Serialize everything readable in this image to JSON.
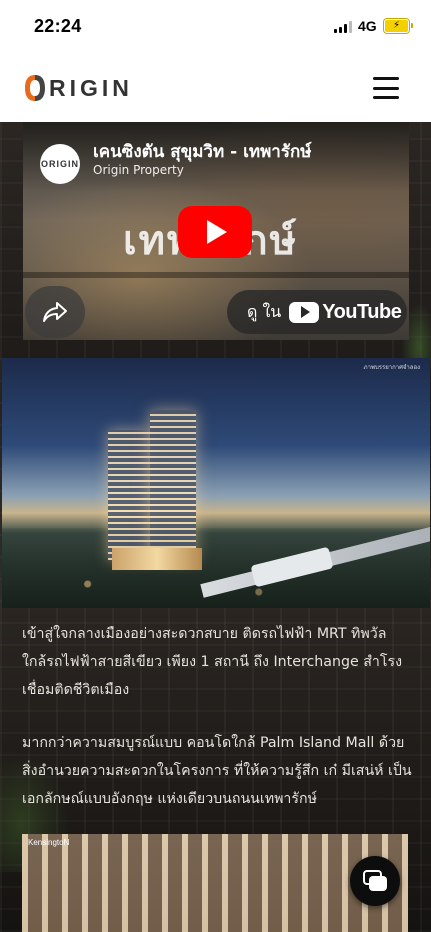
{
  "status_bar": {
    "time": "22:24",
    "network": "4G",
    "battery_icon": "battery-charging-icon"
  },
  "header": {
    "logo_text": "RIGIN",
    "logo_icon": "origin-logo-mark",
    "menu_icon": "hamburger-menu-icon"
  },
  "video": {
    "title": "เคนซิงตัน สุขุมวิท - เทพารักษ์",
    "channel": "Origin Property",
    "avatar_text": "ORIGIN",
    "frame_text": "เทพารักษ์",
    "play_icon": "play-icon",
    "share_icon": "share-icon",
    "watch_on_label": "ดู ใน",
    "youtube_label": "YouTube"
  },
  "render": {
    "caption": "ภาพบรรยากาศจำลอง"
  },
  "description": {
    "p1": "เข้าสู่ใจกลางเมืองอย่างสะดวกสบาย ติดรถไฟฟ้า MRT ทิพวัล ใกล้รถไฟฟ้าสายสีเขียว เพียง 1 สถานี ถึง Interchange สำโรง เชื่อมติดชีวิตเมือง",
    "p2": "มากกว่าความสมบูรณ์แบบ คอนโดใกล้ Palm Island Mall ด้วยสิ่งอำนวยความสะดวกในโครงการ ที่ให้ความรู้สึก เก๋ มีเสน่ห์ เป็นเอกลักษณ์แบบอังกฤษ แห่งเดียวบนถนนเทพารักษ์"
  },
  "bottom_image": {
    "caption": "KensingtoN"
  },
  "chat": {
    "icon": "chat-icon"
  },
  "colors": {
    "youtube_red": "#ff0000",
    "page_bg": "#1a1816",
    "header_bg": "#ffffff",
    "logo_orange": "#e86a1c"
  }
}
